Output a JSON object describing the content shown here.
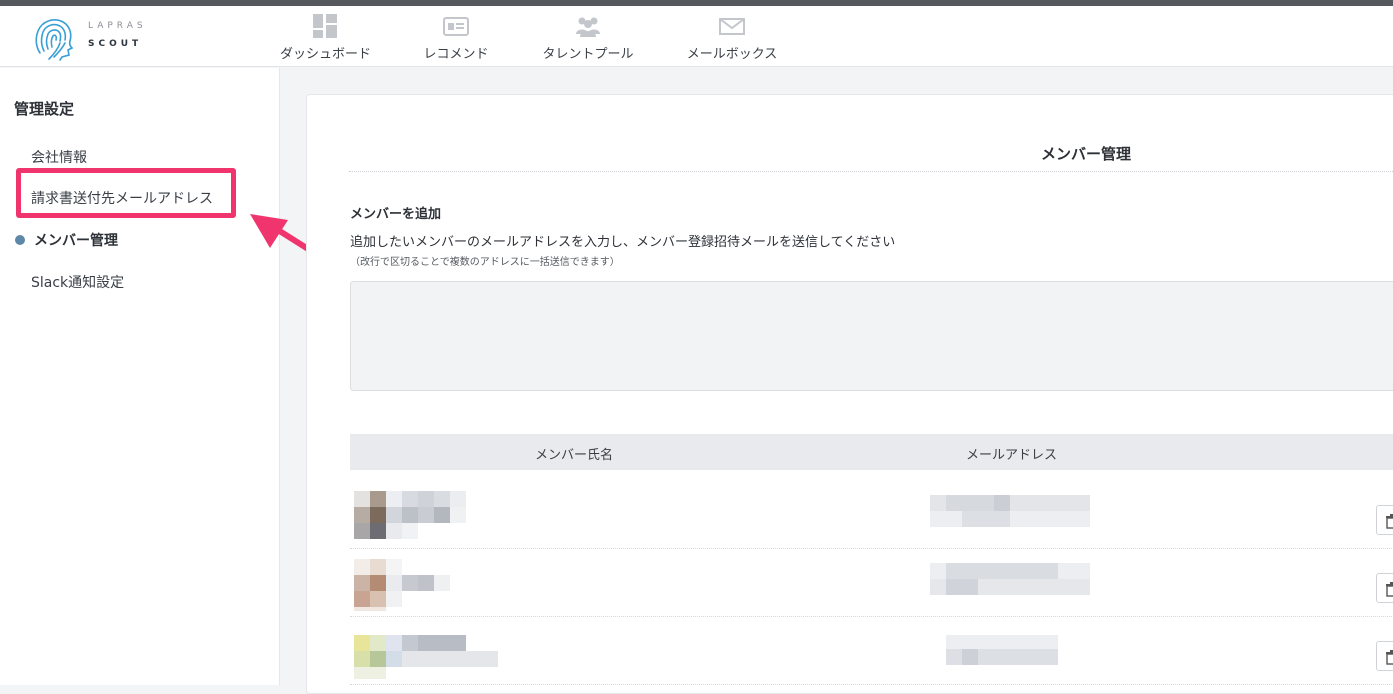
{
  "brand": {
    "line1": "LAPRAS",
    "line2": "SCOUT",
    "logo_icon": "fingerprint-head-icon"
  },
  "nav": {
    "items": [
      {
        "label": "ダッシュボード",
        "icon": "dashboard-grid-icon"
      },
      {
        "label": "レコメンド",
        "icon": "id-card-icon"
      },
      {
        "label": "タレントプール",
        "icon": "users-icon"
      },
      {
        "label": "メールボックス",
        "icon": "envelope-icon"
      }
    ]
  },
  "sidebar": {
    "title": "管理設定",
    "items": [
      {
        "label": "会社情報"
      },
      {
        "label": "請求書送付先メールアドレス"
      },
      {
        "label": "メンバー管理",
        "active": true
      },
      {
        "label": "Slack通知設定"
      }
    ]
  },
  "main": {
    "title": "メンバー管理",
    "add_member": {
      "heading": "メンバーを追加",
      "description": "追加したいメンバーのメールアドレスを入力し、メンバー登録招待メールを送信してください",
      "note": "（改行で区切ることで複数のアドレスに一括送信できます）",
      "textarea_value": ""
    },
    "table": {
      "headers": [
        "メンバー氏名",
        "メールアドレス"
      ],
      "rows": [
        {
          "name": "",
          "email": ""
        },
        {
          "name": "",
          "email": ""
        },
        {
          "name": "",
          "email": ""
        }
      ]
    }
  },
  "colors": {
    "highlight": "#f0356e",
    "active_dot": "#5e88a8"
  }
}
